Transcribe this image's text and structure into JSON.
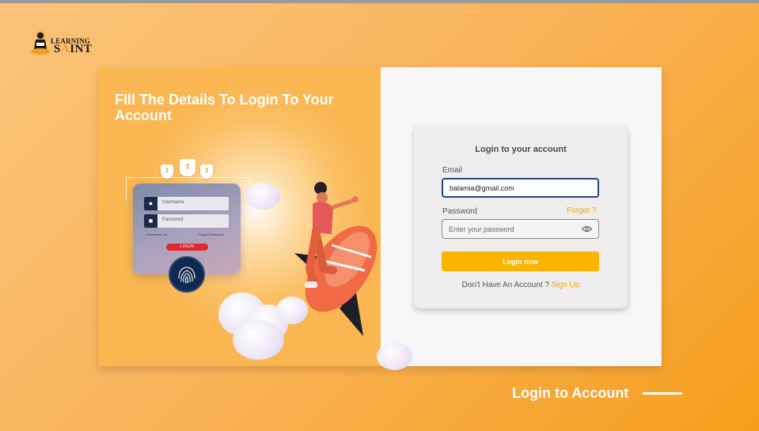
{
  "logo": {
    "line1": "LEARNING",
    "line2_pre": "S",
    "line2_accent": "A",
    "line2_post": "INT"
  },
  "hero": {
    "headline": "FIll The Details To Login To Your Account"
  },
  "illustration": {
    "username_label": "Username",
    "password_label": "Password",
    "remember_label": "Remember me",
    "forgot_label": "Forgot Password?",
    "login_label": "LOGIN",
    "shields": [
      "1",
      "2",
      "3"
    ]
  },
  "form": {
    "title": "Login to your account",
    "email_label": "Email",
    "email_value": "balamia@gmail.com",
    "password_label": "Password",
    "forgot_label": "Forgot ?",
    "password_placeholder": "Enter your password",
    "login_button": "Login now",
    "no_account_text": "Don't Have An Account ?",
    "signup_link": "Sign Up"
  },
  "footer": {
    "title": "Login to  Account"
  },
  "colors": {
    "accent": "#fbb400",
    "link": "#f0a800",
    "background": "#f9b45c"
  }
}
